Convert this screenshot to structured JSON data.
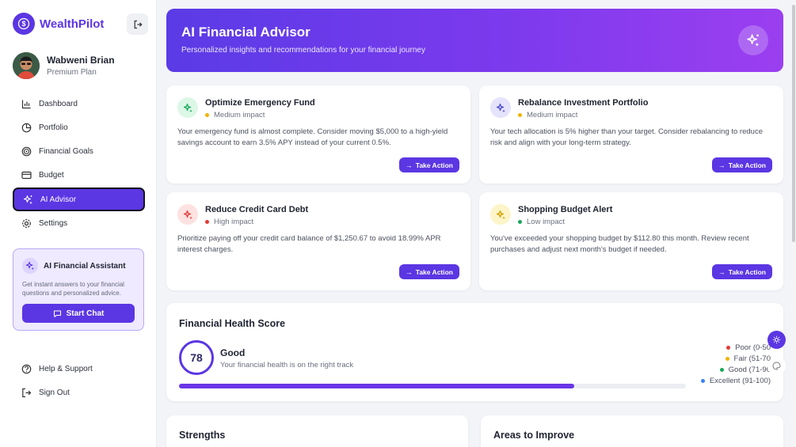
{
  "brand": {
    "name": "WealthPilot",
    "logo_icon": "dollar-icon"
  },
  "user": {
    "name": "Wabweni Brian",
    "plan": "Premium Plan"
  },
  "nav": [
    {
      "label": "Dashboard",
      "icon": "bar-chart-icon",
      "active": false
    },
    {
      "label": "Portfolio",
      "icon": "pie-chart-icon",
      "active": false
    },
    {
      "label": "Financial Goals",
      "icon": "target-icon",
      "active": false
    },
    {
      "label": "Budget",
      "icon": "credit-card-icon",
      "active": false
    },
    {
      "label": "AI Advisor",
      "icon": "sparkles-icon",
      "active": true
    },
    {
      "label": "Settings",
      "icon": "gear-icon",
      "active": false
    }
  ],
  "assistant": {
    "title": "AI Financial Assistant",
    "description": "Get instant answers to your financial questions and personalized advice.",
    "button": "Start Chat"
  },
  "bottom_nav": [
    {
      "label": "Help & Support",
      "icon": "help-icon"
    },
    {
      "label": "Sign Out",
      "icon": "sign-out-icon"
    }
  ],
  "hero": {
    "title": "AI Financial Advisor",
    "subtitle": "Personalized insights and recommendations for your financial journey"
  },
  "recommendations": [
    {
      "title": "Optimize Emergency Fund",
      "impact": "Medium impact",
      "impact_color": "#f0b400",
      "icon_bg": "#dcf7e6",
      "icon_color": "#18a85a",
      "description": "Your emergency fund is almost complete. Consider moving $5,000 to a high-yield savings account to earn 3.5% APY instead of your current 0.5%.",
      "action": "Take Action"
    },
    {
      "title": "Rebalance Investment Portfolio",
      "impact": "Medium impact",
      "impact_color": "#f0b400",
      "icon_bg": "#e4e3fb",
      "icon_color": "#4b4ad6",
      "description": "Your tech allocation is 5% higher than your target. Consider rebalancing to reduce risk and align with your long-term strategy.",
      "action": "Take Action"
    },
    {
      "title": "Reduce Credit Card Debt",
      "impact": "High impact",
      "impact_color": "#e53935",
      "icon_bg": "#fde2e2",
      "icon_color": "#e53935",
      "description": "Prioritize paying off your credit card balance of $1,250.67 to avoid 18.99% APR interest charges.",
      "action": "Take Action"
    },
    {
      "title": "Shopping Budget Alert",
      "impact": "Low impact",
      "impact_color": "#18a85a",
      "icon_bg": "#fdf5c9",
      "icon_color": "#d4a100",
      "description": "You've exceeded your shopping budget by $112.80 this month. Review recent purchases and adjust next month's budget if needed.",
      "action": "Take Action"
    }
  ],
  "health": {
    "title": "Financial Health Score",
    "score": "78",
    "rating": "Good",
    "description": "Your financial health is on the right track",
    "progress_fraction": 0.78,
    "legend": [
      {
        "label": "Poor (0-50",
        "color": "#e53935"
      },
      {
        "label": "Fair (51-70",
        "color": "#f0b400"
      },
      {
        "label": "Good (71-90",
        "color": "#18a85a"
      },
      {
        "label": "Excellent (91-100)",
        "color": "#3b82f6"
      }
    ]
  },
  "sections": {
    "strengths": "Strengths",
    "improve": "Areas to Improve"
  },
  "colors": {
    "accent": "#5b36e3"
  }
}
